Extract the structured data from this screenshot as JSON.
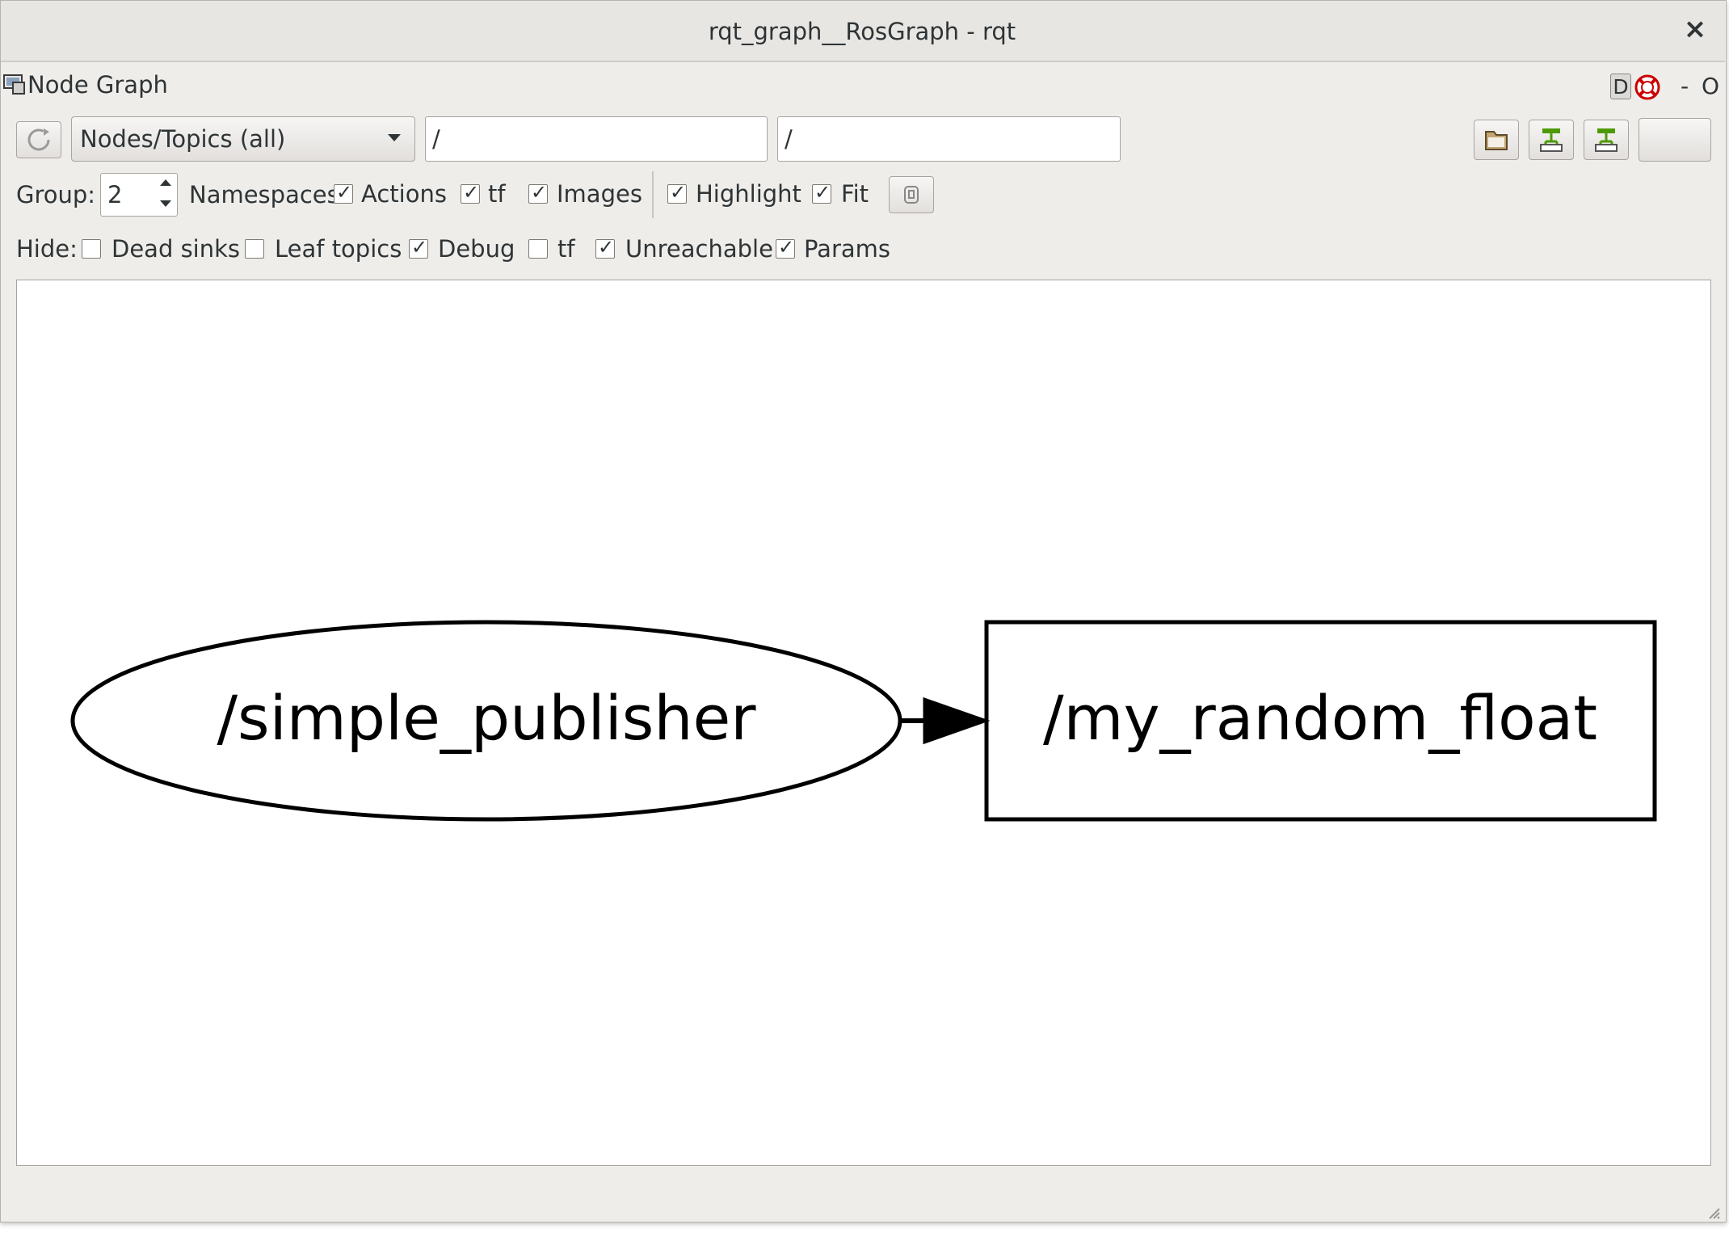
{
  "window": {
    "title": "rqt_graph__RosGraph - rqt",
    "close_glyph": "×"
  },
  "plugin": {
    "title": "Node Graph",
    "d_button": "D",
    "dash": "-",
    "o": "O"
  },
  "toolbar": {
    "graph_type": "Nodes/Topics (all)",
    "node_filter": "/",
    "topic_filter": "/"
  },
  "options": {
    "group_label": "Group:",
    "group_value": "2",
    "namespaces_label": "Namespaces",
    "actions": {
      "label": "Actions",
      "checked": true
    },
    "tf": {
      "label": "tf",
      "checked": true
    },
    "images": {
      "label": "Images",
      "checked": true
    },
    "highlight": {
      "label": "Highlight",
      "checked": true
    },
    "fit": {
      "label": "Fit",
      "checked": true
    }
  },
  "hide": {
    "label": "Hide:",
    "dead_sinks": {
      "label": "Dead sinks",
      "checked": false
    },
    "leaf_topics": {
      "label": "Leaf topics",
      "checked": false
    },
    "debug": {
      "label": "Debug",
      "checked": true
    },
    "tf": {
      "label": "tf",
      "checked": false
    },
    "unreachable": {
      "label": "Unreachable",
      "checked": true
    },
    "params": {
      "label": "Params",
      "checked": true
    }
  },
  "graph": {
    "node": "/simple_publisher",
    "topic": "/my_random_float"
  },
  "colors": {
    "window_bg": "#efedea",
    "canvas_bg": "#ffffff",
    "graph_stroke": "#000000",
    "icon_green": "#4e9a06"
  },
  "icons": [
    "window-icon",
    "help-icon",
    "refresh-icon",
    "open-file-icon",
    "save-dot-icon",
    "save-image-icon",
    "fit-view-icon"
  ],
  "check_glyph": "✓"
}
